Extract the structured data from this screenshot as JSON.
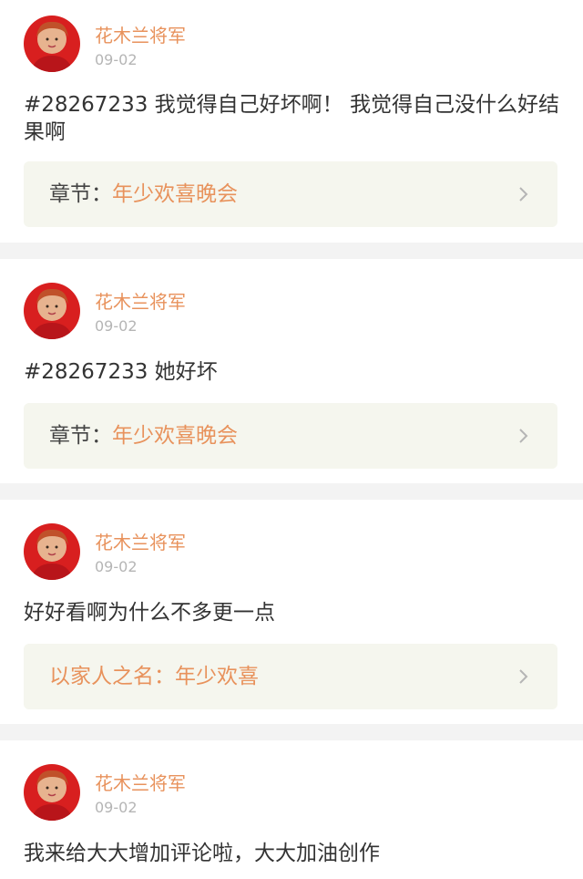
{
  "comments": [
    {
      "username": "花木兰将军",
      "date": "09-02",
      "text": "#28267233 我觉得自己好坏啊！ 我觉得自己没什么好结果啊",
      "link_prefix": "章节：",
      "link_title": "年少欢喜晚会"
    },
    {
      "username": "花木兰将军",
      "date": "09-02",
      "text": "#28267233 她好坏",
      "link_prefix": "章节：",
      "link_title": "年少欢喜晚会"
    },
    {
      "username": "花木兰将军",
      "date": "09-02",
      "text": "好好看啊为什么不多更一点",
      "link_prefix": "",
      "link_title": "以家人之名：年少欢喜"
    },
    {
      "username": "花木兰将军",
      "date": "09-02",
      "text": "我来给大大增加评论啦，大大加油创作"
    }
  ],
  "icons": {
    "avatar": "avatar-image",
    "chevron": "chevron-right-icon"
  },
  "colors": {
    "username": "#e8925c",
    "link_title": "#e8925c",
    "date": "#b5b5b5",
    "chapter_bg": "#f5f6ee",
    "page_bg": "#f3f3f3"
  }
}
